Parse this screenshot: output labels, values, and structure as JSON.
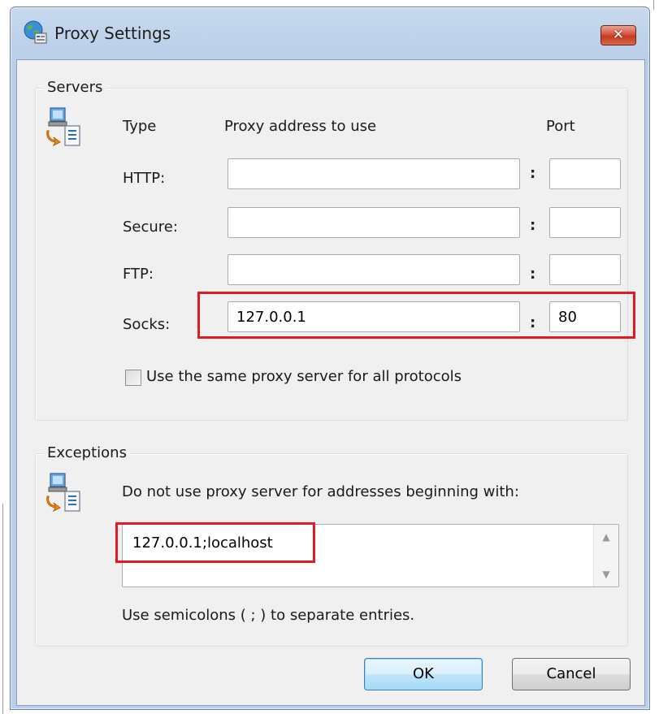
{
  "window": {
    "title": "Proxy Settings",
    "close_label": "✕"
  },
  "servers": {
    "group_label": "Servers",
    "col_type": "Type",
    "col_address": "Proxy address to use",
    "col_port": "Port",
    "colon": ":",
    "rows": [
      {
        "label": "HTTP:",
        "address": "",
        "port": ""
      },
      {
        "label": "Secure:",
        "address": "",
        "port": ""
      },
      {
        "label": "FTP:",
        "address": "",
        "port": ""
      },
      {
        "label": "Socks:",
        "address": "127.0.0.1",
        "port": "80"
      }
    ],
    "same_proxy_label": "Use the same proxy server for all protocols",
    "same_proxy_checked": false
  },
  "exceptions": {
    "group_label": "Exceptions",
    "instruction": "Do not use proxy server for addresses beginning with:",
    "value": "127.0.0.1;localhost",
    "hint": "Use semicolons ( ; ) to separate entries."
  },
  "buttons": {
    "ok": "OK",
    "cancel": "Cancel"
  },
  "colors": {
    "highlight": "#e01b24",
    "titlebar": "#bed2ea",
    "close_button": "#c23a20"
  }
}
